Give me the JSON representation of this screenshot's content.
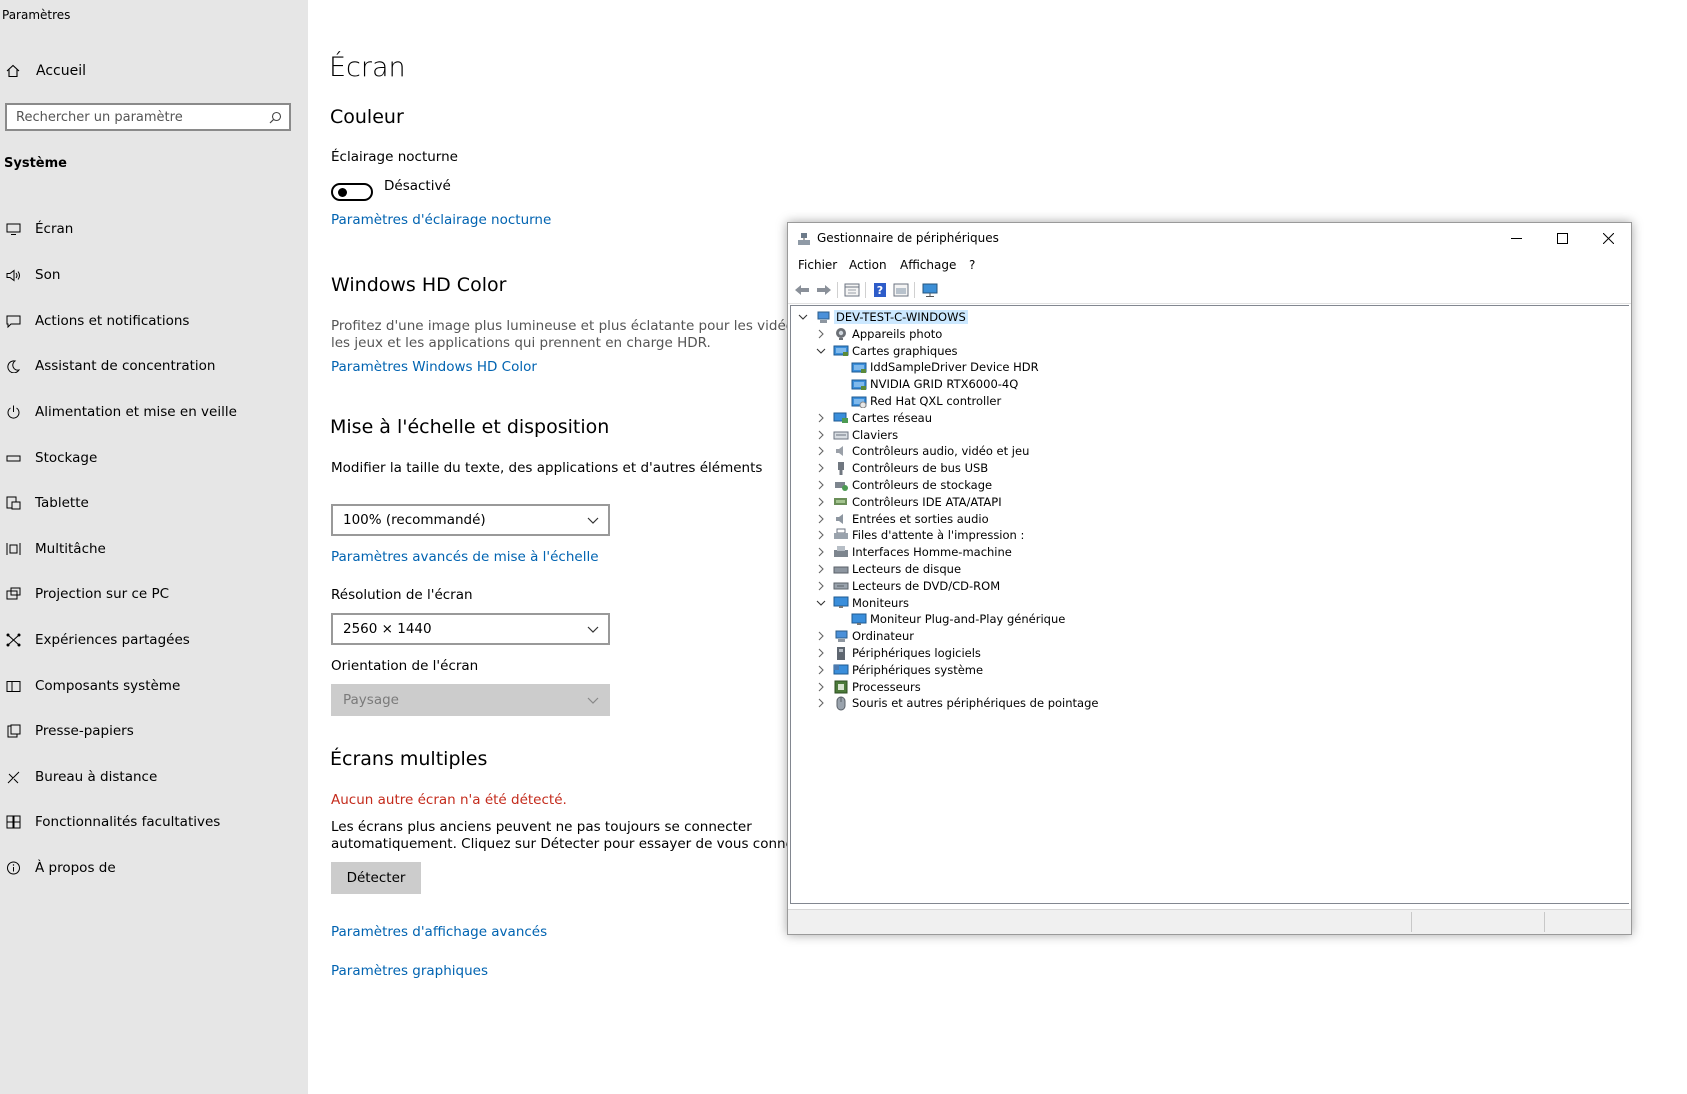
{
  "settings": {
    "app_title": "Paramètres",
    "home_label": "Accueil",
    "search_placeholder": "Rechercher un paramètre",
    "section_label": "Système",
    "nav_items": [
      {
        "label": "Écran",
        "icon": "monitor-icon"
      },
      {
        "label": "Son",
        "icon": "speaker-icon"
      },
      {
        "label": "Actions et notifications",
        "icon": "notification-icon"
      },
      {
        "label": "Assistant de concentration",
        "icon": "moon-icon"
      },
      {
        "label": "Alimentation et mise en veille",
        "icon": "power-icon"
      },
      {
        "label": "Stockage",
        "icon": "storage-icon"
      },
      {
        "label": "Tablette",
        "icon": "tablet-icon"
      },
      {
        "label": "Multitâche",
        "icon": "multitask-icon"
      },
      {
        "label": "Projection sur ce PC",
        "icon": "projection-icon"
      },
      {
        "label": "Expériences partagées",
        "icon": "shared-icon"
      },
      {
        "label": "Composants système",
        "icon": "components-icon"
      },
      {
        "label": "Presse-papiers",
        "icon": "clipboard-icon"
      },
      {
        "label": "Bureau à distance",
        "icon": "remote-desktop-icon"
      },
      {
        "label": "Fonctionnalités facultatives",
        "icon": "optional-features-icon"
      },
      {
        "label": "À propos de",
        "icon": "info-icon"
      }
    ],
    "main": {
      "title": "Écran",
      "color_heading": "Couleur",
      "night_light_label": "Éclairage nocturne",
      "night_light_state": "Désactivé",
      "night_light_link": "Paramètres d'éclairage nocturne",
      "hdr_heading": "Windows HD Color",
      "hdr_desc_line1": "Profitez d'une image plus lumineuse et plus éclatante pour les vidéos,",
      "hdr_desc_line2": "les jeux et les applications qui prennent en charge HDR.",
      "hdr_link": "Paramètres Windows HD Color",
      "scale_heading": "Mise à l'échelle et disposition",
      "scale_label": "Modifier la taille du texte, des applications et d'autres éléments",
      "scale_value": "100% (recommandé)",
      "scale_link": "Paramètres avancés de mise à l'échelle",
      "resolution_label": "Résolution de l'écran",
      "resolution_value": "2560 × 1440",
      "orientation_label": "Orientation de l'écran",
      "orientation_value": "Paysage",
      "multi_heading": "Écrans multiples",
      "multi_error": "Aucun autre écran n'a été détecté.",
      "multi_desc_line1": "Les écrans plus anciens peuvent ne pas toujours se connecter",
      "multi_desc_line2": "automatiquement. Cliquez sur Détecter pour essayer de vous connecter.",
      "detect_button": "Détecter",
      "advanced_display_link": "Paramètres d'affichage avancés",
      "graphics_link": "Paramètres graphiques"
    }
  },
  "device_manager": {
    "title": "Gestionnaire de périphériques",
    "menu": [
      "Fichier",
      "Action",
      "Affichage",
      "?"
    ],
    "toolbar": [
      "back-arrow-icon",
      "forward-arrow-icon",
      "properties-icon",
      "help-icon",
      "update-driver-icon",
      "scan-hardware-icon"
    ],
    "tree": [
      {
        "label": "DEV-TEST-C-WINDOWS",
        "level": 0,
        "state": "expanded",
        "icon": "computer-icon",
        "selected": true
      },
      {
        "label": "Appareils photo",
        "level": 1,
        "state": "collapsed",
        "icon": "camera-icon"
      },
      {
        "label": "Cartes graphiques",
        "level": 1,
        "state": "expanded",
        "icon": "display-adapter-icon"
      },
      {
        "label": "IddSampleDriver Device HDR",
        "level": 2,
        "state": "leaf",
        "icon": "display-adapter-icon"
      },
      {
        "label": "NVIDIA GRID RTX6000-4Q",
        "level": 2,
        "state": "leaf",
        "icon": "display-adapter-icon"
      },
      {
        "label": "Red Hat QXL controller",
        "level": 2,
        "state": "leaf",
        "icon": "display-adapter-warning-icon"
      },
      {
        "label": "Cartes réseau",
        "level": 1,
        "state": "collapsed",
        "icon": "network-icon"
      },
      {
        "label": "Claviers",
        "level": 1,
        "state": "collapsed",
        "icon": "keyboard-icon"
      },
      {
        "label": "Contrôleurs audio, vidéo et jeu",
        "level": 1,
        "state": "collapsed",
        "icon": "audio-icon"
      },
      {
        "label": "Contrôleurs de bus USB",
        "level": 1,
        "state": "collapsed",
        "icon": "usb-icon"
      },
      {
        "label": "Contrôleurs de stockage",
        "level": 1,
        "state": "collapsed",
        "icon": "storage-controller-icon"
      },
      {
        "label": "Contrôleurs IDE ATA/ATAPI",
        "level": 1,
        "state": "collapsed",
        "icon": "ide-icon"
      },
      {
        "label": "Entrées et sorties audio",
        "level": 1,
        "state": "collapsed",
        "icon": "audio-io-icon"
      },
      {
        "label": "Files d'attente à l'impression :",
        "level": 1,
        "state": "collapsed",
        "icon": "printer-icon"
      },
      {
        "label": "Interfaces Homme-machine",
        "level": 1,
        "state": "collapsed",
        "icon": "hid-icon"
      },
      {
        "label": "Lecteurs de disque",
        "level": 1,
        "state": "collapsed",
        "icon": "disk-icon"
      },
      {
        "label": "Lecteurs de DVD/CD-ROM",
        "level": 1,
        "state": "collapsed",
        "icon": "dvd-icon"
      },
      {
        "label": "Moniteurs",
        "level": 1,
        "state": "expanded",
        "icon": "monitor-icon"
      },
      {
        "label": "Moniteur Plug-and-Play générique",
        "level": 2,
        "state": "leaf",
        "icon": "monitor-icon"
      },
      {
        "label": "Ordinateur",
        "level": 1,
        "state": "collapsed",
        "icon": "computer-icon"
      },
      {
        "label": "Périphériques logiciels",
        "level": 1,
        "state": "collapsed",
        "icon": "software-device-icon"
      },
      {
        "label": "Périphériques système",
        "level": 1,
        "state": "collapsed",
        "icon": "system-device-icon"
      },
      {
        "label": "Processeurs",
        "level": 1,
        "state": "collapsed",
        "icon": "processor-icon"
      },
      {
        "label": "Souris et autres périphériques de pointage",
        "level": 1,
        "state": "collapsed",
        "icon": "mouse-icon"
      }
    ]
  },
  "colors": {
    "link": "#0063b1",
    "error": "#c42b1c",
    "sidebar_bg": "#e6e6e6",
    "selection": "#cce8ff"
  }
}
